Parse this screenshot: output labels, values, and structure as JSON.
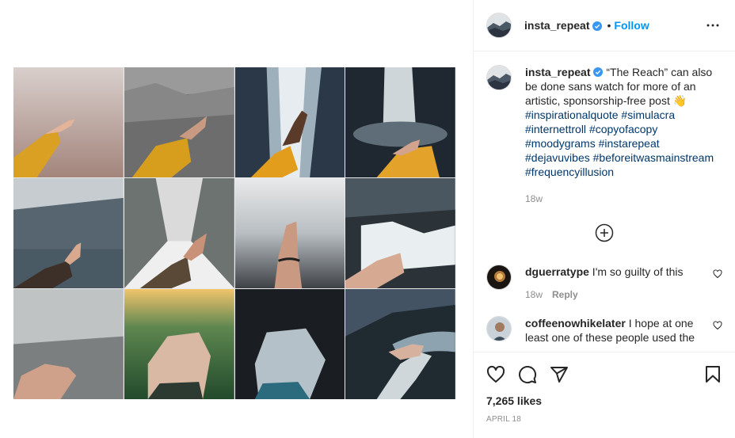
{
  "post": {
    "username": "insta_repeat",
    "follow_label": "Follow",
    "dot": "•",
    "caption_text": " “The Reach” can also be done sans watch for more of an artistic, sponsorship-free post 👋",
    "hashtags": [
      "#inspirationalquote",
      "#simulacra",
      "#internettroll",
      "#copyofacopy",
      "#moodygrams",
      "#instarepeat",
      "#dejavuvibes",
      "#beforeitwasmainstream",
      "#frequencyillusion"
    ],
    "caption_time": "18w",
    "likes": "7,265 likes",
    "date": "APRIL 18"
  },
  "comments": [
    {
      "username": "dguerratype",
      "text": " I'm so guilty of this",
      "time": "18w",
      "reply": "Reply"
    },
    {
      "username": "coffeenowhikelater",
      "text": " I hope at one least one of these people used the",
      "time": "",
      "reply": ""
    }
  ],
  "icons": {
    "more": "more-options-icon",
    "verified": "verified-badge-icon",
    "load_more": "load-more-icon",
    "like": "heart-icon",
    "comment": "comment-icon",
    "share": "share-icon",
    "save": "bookmark-icon"
  },
  "colors": {
    "accent": "#0095f6",
    "hashtag": "#00376b",
    "muted": "#8e8e8e",
    "text": "#262626"
  }
}
